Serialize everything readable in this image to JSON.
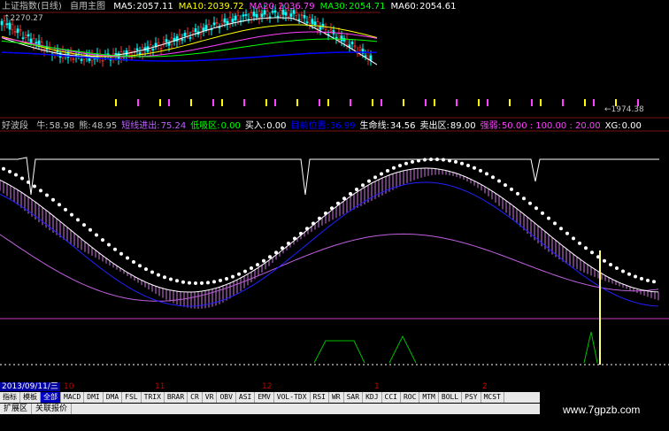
{
  "header": {
    "title": "上证指数(日线)",
    "template": "自用主图",
    "ma": [
      {
        "label": "MA5:",
        "value": "2057.11",
        "color": "#ffffff"
      },
      {
        "label": "MA10:",
        "value": "2039.72",
        "color": "#ffff00"
      },
      {
        "label": "MA20:",
        "value": "2036.79",
        "color": "#ff40ff"
      },
      {
        "label": "MA30:",
        "value": "2054.71",
        "color": "#00ff00"
      },
      {
        "label": "MA60:",
        "value": "2054.61",
        "color": "#ffffff"
      }
    ]
  },
  "price": {
    "high_label": "2270.27",
    "low_label": "1974.38"
  },
  "indicator": {
    "name": "好波段",
    "fields": [
      {
        "label": "牛:",
        "value": "58.98",
        "color": "#c0c0c0"
      },
      {
        "label": "熊:",
        "value": "48.95",
        "color": "#c0c0c0"
      },
      {
        "label": "短线进出:",
        "value": "75.24",
        "color": "#c060ff"
      },
      {
        "label": "低吸区:",
        "value": "0.00",
        "color": "#00ff00"
      },
      {
        "label": "买入:",
        "value": "0.00",
        "color": "#ffffff"
      },
      {
        "label": "目前位置:",
        "value": "36.99",
        "color": "#0000ff"
      },
      {
        "label": "生命线:",
        "value": "34.56",
        "color": "#ffffff"
      },
      {
        "label": "卖出区:",
        "value": "89.00",
        "color": "#ffffff"
      },
      {
        "label": "强弱:",
        "value": "50.00 : 100.00 : 20.00",
        "color": "#ff40ff"
      },
      {
        "label": "XG:",
        "value": "0.00",
        "color": "#ffffff"
      }
    ]
  },
  "date_axis": {
    "current_date": "2013/09/11/三",
    "ticks": [
      "10",
      "11",
      "12",
      "1",
      "2"
    ]
  },
  "tabs": {
    "row1": [
      "指标",
      "模板",
      "全部",
      "MACD",
      "DMI",
      "DMA",
      "FSL",
      "TRIX",
      "BRAR",
      "CR",
      "VR",
      "OBV",
      "ASI",
      "EMV",
      "VOL-TDX",
      "RSI",
      "WR",
      "SAR",
      "KDJ",
      "CCI",
      "ROC",
      "MTM",
      "BOLL",
      "PSY",
      "MCST"
    ],
    "row1_active": "全部",
    "row2": [
      "扩展区",
      "关联报价"
    ]
  },
  "watermark": "www.7gpzb.com",
  "colors": {
    "background": "#000000",
    "separator": "#7a1010",
    "accent": "#ff40ff"
  }
}
